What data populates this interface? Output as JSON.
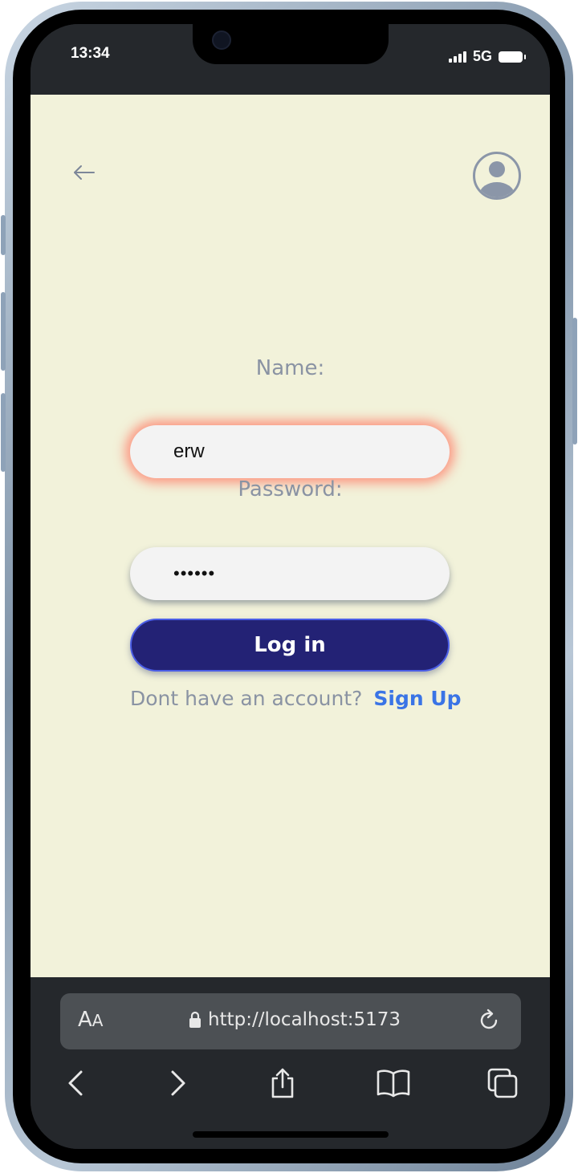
{
  "status_bar": {
    "time": "13:34",
    "network": "5G"
  },
  "header": {
    "back_icon": "arrow-left-icon",
    "profile_icon": "user-avatar-icon"
  },
  "form": {
    "name_label": "Name:",
    "name_value": "erw",
    "password_label": "Password:",
    "password_value": "••••••",
    "login_label": "Log in",
    "signup_prompt": "Dont have an account?",
    "signup_link": "Sign Up"
  },
  "browser": {
    "text_size_label": "AA",
    "url": "http://localhost:5173",
    "nav_icons": [
      "back-icon",
      "forward-icon",
      "share-icon",
      "bookmarks-icon",
      "tabs-icon"
    ]
  },
  "colors": {
    "page_background": "#f2f2da",
    "button": "#232275",
    "link": "#3a74e6",
    "label": "#8a93a3",
    "focus_glow": "#ff7864"
  }
}
